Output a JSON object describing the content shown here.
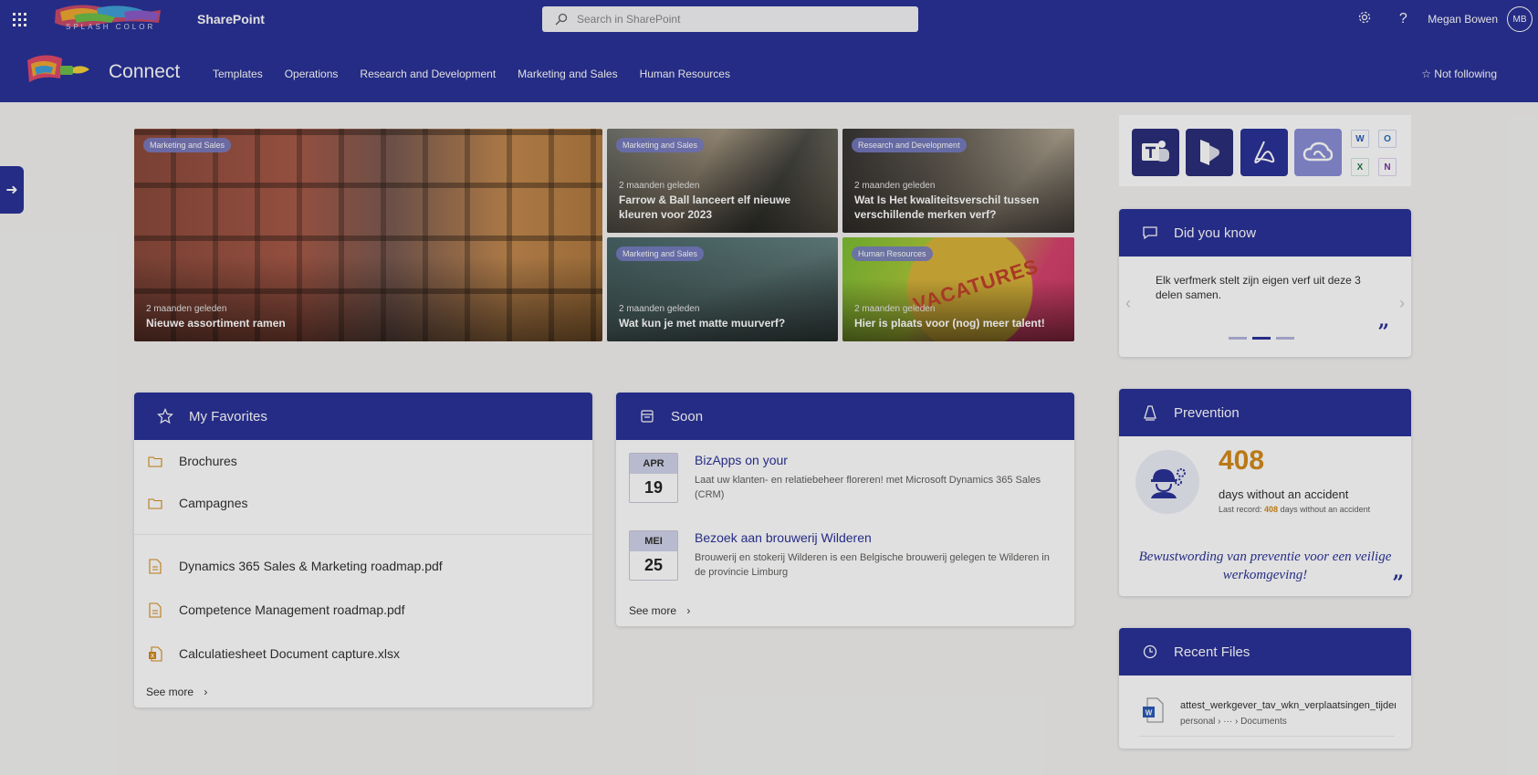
{
  "topbar": {
    "brand_text": "SPLASH COLOR",
    "app_name": "SharePoint",
    "search_placeholder": "Search in SharePoint",
    "user_name": "Megan Bowen",
    "user_initials": "MB"
  },
  "site": {
    "title": "Connect",
    "nav": [
      "Templates",
      "Operations",
      "Research and Development",
      "Marketing and Sales",
      "Human Resources"
    ],
    "follow_label": "Not following"
  },
  "news": [
    {
      "badge": "Marketing and Sales",
      "age": "2 maanden geleden",
      "title": "Nieuwe assortiment ramen"
    },
    {
      "badge": "Marketing and Sales",
      "age": "2 maanden geleden",
      "title": "Farrow & Ball lanceert elf nieuwe kleuren voor 2023"
    },
    {
      "badge": "Research and Development",
      "age": "2 maanden geleden",
      "title": "Wat Is Het kwaliteitsverschil tussen verschillende merken verf?"
    },
    {
      "badge": "Marketing and Sales",
      "age": "2 maanden geleden",
      "title": "Wat kun je met matte muurverf?"
    },
    {
      "badge": "Human Resources",
      "age": "2 maanden geleden",
      "title": "Hier is plaats voor (nog) meer talent!",
      "image_text": "VACATURES"
    }
  ],
  "favorites": {
    "title": "My Favorites",
    "folders": [
      "Brochures",
      "Campagnes"
    ],
    "files": [
      "Dynamics 365 Sales & Marketing roadmap.pdf",
      "Competence Management roadmap.pdf",
      "Calculatiesheet Document capture.xlsx"
    ],
    "see_more": "See more"
  },
  "soon": {
    "title": "Soon",
    "events": [
      {
        "month": "APR",
        "day": "19",
        "title": "BizApps on your",
        "desc": "Laat uw klanten- en relatiebeheer floreren! met Microsoft Dynamics 365 Sales (CRM)"
      },
      {
        "month": "MEI",
        "day": "25",
        "title": "Bezoek aan brouwerij Wilderen",
        "desc": "Brouwerij en stokerij Wilderen is een Belgische brouwerij gelegen te Wilderen in de provincie Limburg"
      }
    ],
    "see_more": "See more"
  },
  "apps": {
    "icons": [
      "teams-icon",
      "dynamics-icon",
      "acrobat-icon",
      "creative-cloud-icon",
      "word-icon",
      "outlook-icon",
      "excel-icon",
      "onenote-icon"
    ]
  },
  "did_you_know": {
    "title": "Did you know",
    "text": "Elk verfmerk stelt zijn eigen verf uit deze 3 delen samen.",
    "active_slide": 2,
    "slide_count": 3
  },
  "prevention": {
    "title": "Prevention",
    "days": "408",
    "days_label": "days without an accident",
    "last_record_prefix": "Last record:",
    "last_record_value": "408",
    "last_record_suffix": "days without an accident",
    "slogan": "Bewustwording van preventie voor een veilige werkomgeving!"
  },
  "recent_files": {
    "title": "Recent Files",
    "file_name": "attest_werkgever_tav_wkn_verplaatsingen_tijdens_co",
    "path_start": "personal",
    "path_end": "Documents"
  },
  "colors": {
    "theme": "#2b3398",
    "accent_number": "#d48a1a"
  }
}
